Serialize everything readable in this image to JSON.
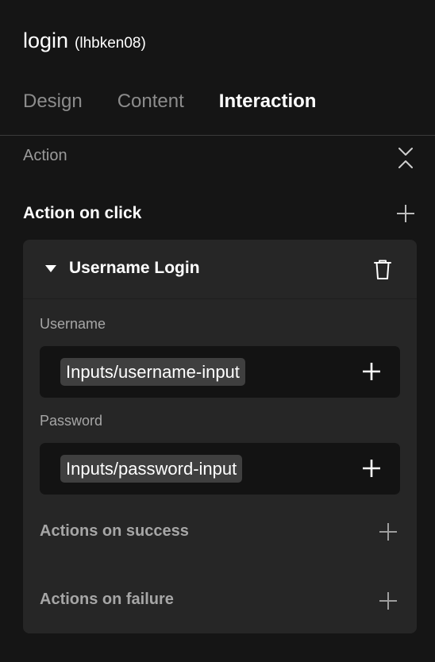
{
  "header": {
    "title": "login",
    "id": "(lhbken08)"
  },
  "tabs": [
    {
      "label": "Design",
      "active": false
    },
    {
      "label": "Content",
      "active": false
    },
    {
      "label": "Interaction",
      "active": true
    }
  ],
  "section": {
    "label": "Action",
    "collapse_icon": "collapse-icon"
  },
  "action_on_click": {
    "label": "Action on click",
    "add_icon": "plus-icon"
  },
  "action_card": {
    "title": "Username Login",
    "expanded": true,
    "delete_icon": "trash-icon",
    "fields": [
      {
        "label": "Username",
        "value": "Inputs/username-input",
        "add_icon": "plus-icon"
      },
      {
        "label": "Password",
        "value": "Inputs/password-input",
        "add_icon": "plus-icon"
      }
    ],
    "on_success": {
      "label": "Actions on success",
      "add_icon": "plus-icon"
    },
    "on_failure": {
      "label": "Actions on failure",
      "add_icon": "plus-icon"
    }
  },
  "colors": {
    "background": "#151515",
    "card": "#262626",
    "field": "#131313",
    "chip": "#3f3f3f",
    "muted_text": "#8c8c8c"
  }
}
